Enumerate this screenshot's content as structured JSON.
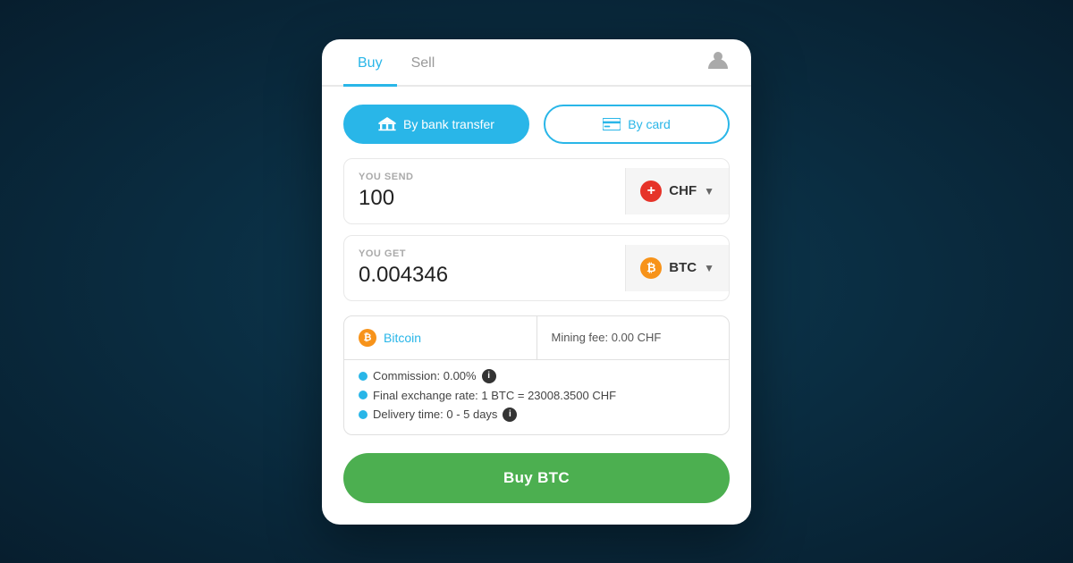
{
  "tabs": {
    "buy_label": "Buy",
    "sell_label": "Sell",
    "active_tab": "buy"
  },
  "payment_methods": {
    "bank_transfer_label": "By bank transfer",
    "card_label": "By card",
    "active": "bank"
  },
  "you_send": {
    "label": "YOU SEND",
    "value": "100",
    "currency_code": "CHF",
    "currency_icon": "chf-flag-icon"
  },
  "you_get": {
    "label": "YOU GET",
    "value": "0.004346",
    "currency_code": "BTC",
    "currency_icon": "btc-icon"
  },
  "details": {
    "bitcoin_label": "Bitcoin",
    "mining_fee_label": "Mining fee: 0.00 CHF",
    "commission_label": "Commission: 0.00%",
    "exchange_rate_label": "Final exchange rate: 1 BTC = 23008.3500 CHF",
    "delivery_time_label": "Delivery time: 0 - 5 days"
  },
  "buy_button": {
    "label": "Buy BTC"
  },
  "colors": {
    "accent": "#29b6e8",
    "btc_orange": "#f7931a",
    "chf_red": "#e63329",
    "green": "#4caf50"
  }
}
